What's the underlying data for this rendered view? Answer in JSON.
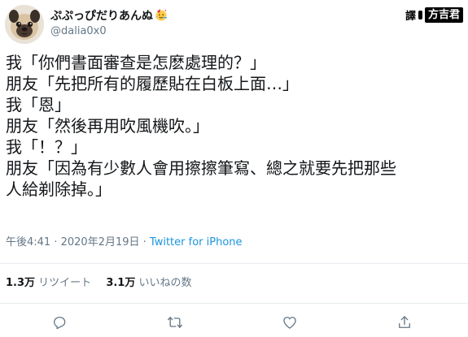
{
  "user": {
    "display_name": "ぷぷっぴだりあんぬ",
    "handle": "@dalia0x0",
    "name_emoji": "party-face"
  },
  "translator": {
    "label": "譯",
    "name": "方吉君"
  },
  "tweet": {
    "lines": [
      "我「你們書面審查是怎麽處理的？」",
      "朋友「先把所有的履歷貼在白板上面…」",
      "我「恩」",
      "朋友「然後再用吹風機吹。」",
      "我「！？」",
      "朋友「因為有少數人會用擦擦筆寫、總之就要先把那些",
      "人給剃除掉。」"
    ]
  },
  "meta": {
    "time": "午後4:41",
    "separator": " · ",
    "date": "2020年2月19日",
    "separator2": " · ",
    "source": "Twitter for iPhone"
  },
  "stats": {
    "retweets_count": "1.3万",
    "retweets_label": "リツイート",
    "likes_count": "3.1万",
    "likes_label": "いいねの数"
  },
  "colors": {
    "link": "#1b95e0",
    "muted": "#657786",
    "text": "#14171a",
    "divider": "#e6ecf0"
  },
  "icons": [
    "reply-icon",
    "retweet-icon",
    "like-icon",
    "share-icon"
  ]
}
